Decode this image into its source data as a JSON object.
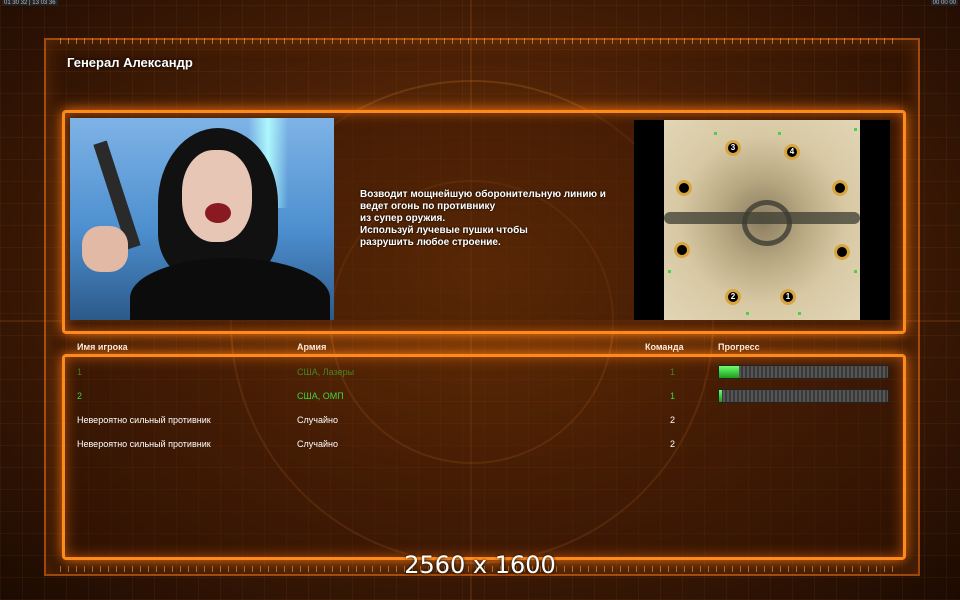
{
  "topbar": {
    "left": "01 30 32 | 13 03 36",
    "right": "00 00 00"
  },
  "title": "Генерал Александр",
  "description": "Возводит мощнейшую оборонительную линию и\n ведет огонь по противнику\nиз супер оружия.\nИспользуй лучевые пушки чтобы\nразрушить любое строение.",
  "map": {
    "start_positions": [
      "3",
      "4",
      "2",
      "1"
    ]
  },
  "table": {
    "headers": {
      "name": "Имя игрока",
      "army": "Армия",
      "team": "Команда",
      "progress": "Прогресс"
    },
    "rows": [
      {
        "name": "1",
        "army": "США, Лазеры",
        "team": "1",
        "color": "#3fd43f",
        "progress": 0.12
      },
      {
        "name": "2",
        "army": "США, ОМП",
        "team": "1",
        "color": "#3fd43f",
        "progress": 0.02
      },
      {
        "name": "Невероятно сильный противник",
        "army": "Случайно",
        "team": "2",
        "color": "#ffffff"
      },
      {
        "name": "Невероятно сильный противник",
        "army": "Случайно",
        "team": "2",
        "color": "#ffffff"
      }
    ]
  },
  "resolution_label": "2560 x 1600",
  "colors": {
    "accent": "#ff8a1c",
    "player": "#3fd43f",
    "background": "#4a2006"
  },
  "icons": {
    "player_marker": "green-square-dot",
    "start_marker": "numbered-circle"
  }
}
